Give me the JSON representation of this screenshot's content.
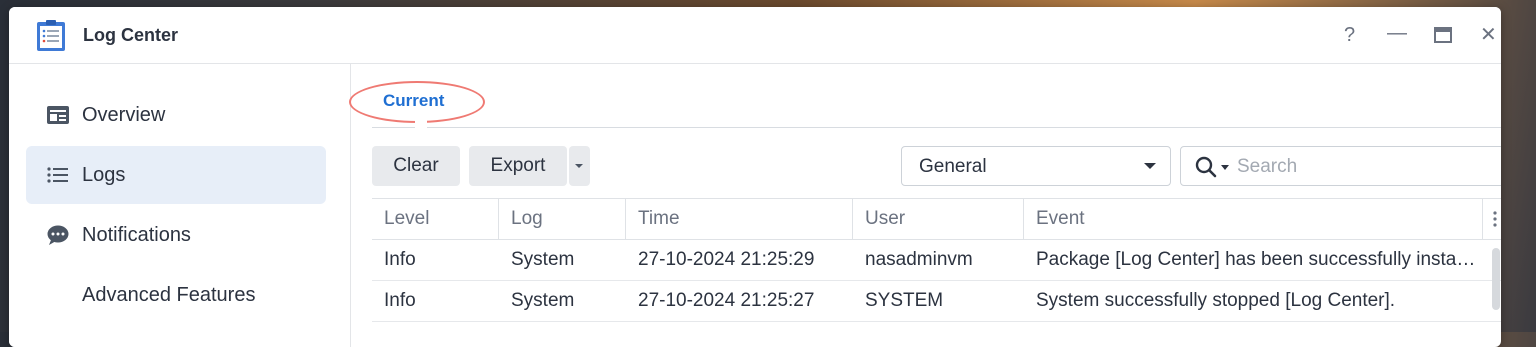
{
  "window": {
    "title": "Log Center",
    "controls": {
      "help": "?",
      "minimize": "—",
      "close": "✕"
    }
  },
  "sidebar": {
    "items": [
      {
        "label": "Overview",
        "icon": "overview-icon",
        "active": false
      },
      {
        "label": "Logs",
        "icon": "list-icon",
        "active": true
      },
      {
        "label": "Notifications",
        "icon": "chat-bubble-icon",
        "active": false
      },
      {
        "label": "Advanced Features",
        "icon": "",
        "active": false
      }
    ]
  },
  "main": {
    "tabs": [
      {
        "label": "Current",
        "active": true
      }
    ],
    "toolbar": {
      "clear_label": "Clear",
      "export_label": "Export",
      "filter_value": "General",
      "search_placeholder": "Search"
    },
    "table": {
      "columns": [
        "Level",
        "Log",
        "Time",
        "User",
        "Event"
      ],
      "rows": [
        [
          "Info",
          "System",
          "27-10-2024 21:25:29",
          "nasadminvm",
          "Package [Log Center] has been successfully installed."
        ],
        [
          "Info",
          "System",
          "27-10-2024 21:25:27",
          "SYSTEM",
          "System successfully stopped [Log Center]."
        ]
      ]
    }
  },
  "colors": {
    "accent": "#1f6fd2",
    "active_sidebar_bg": "#e7eef8",
    "annotation": "#ef7a73"
  }
}
